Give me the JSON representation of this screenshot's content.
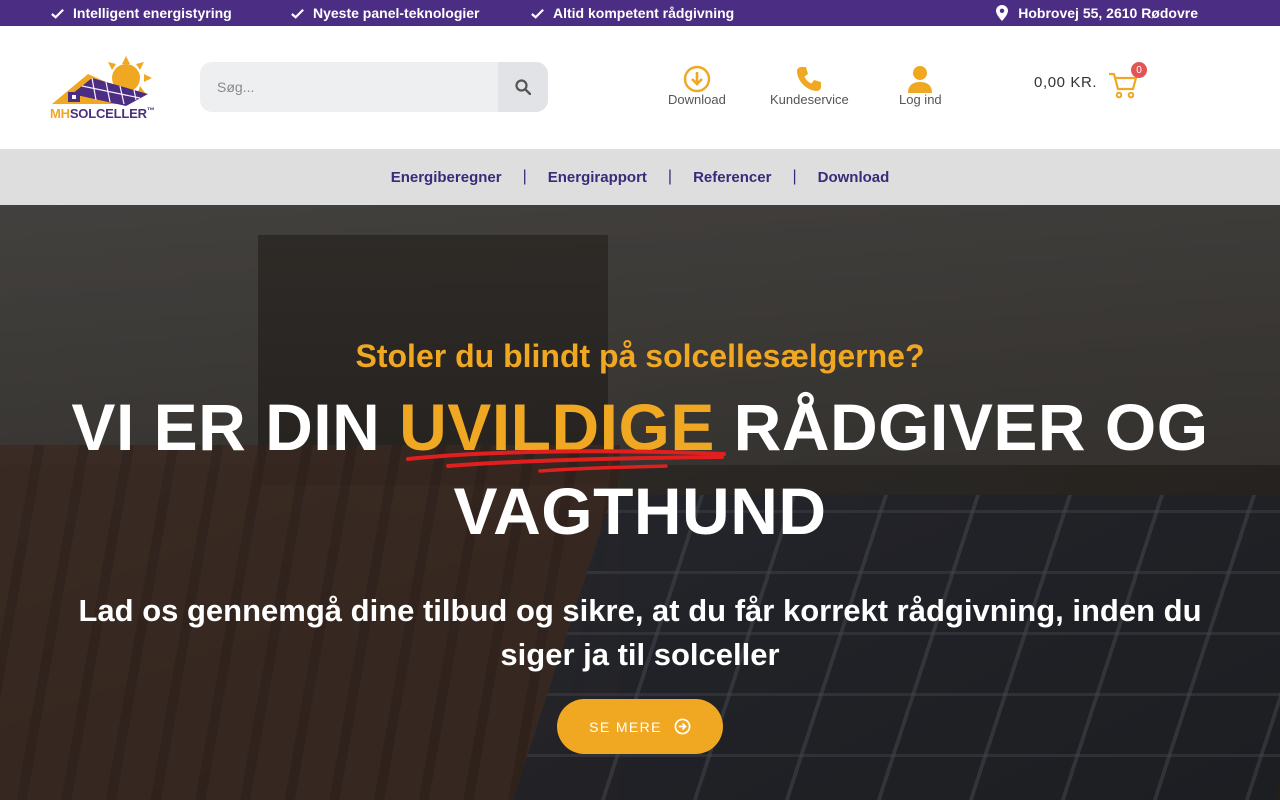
{
  "topbar": {
    "usps": [
      "Intelligent energistyring",
      "Nyeste panel-teknologier",
      "Altid kompetent rådgivning"
    ],
    "address": "Hobrovej 55, 2610 Rødovre"
  },
  "header": {
    "logo": {
      "prefix": "MH",
      "name": "SOLCELLER",
      "tm": "™"
    },
    "search": {
      "placeholder": "Søg..."
    },
    "icons": {
      "download": "Download",
      "customer_service": "Kundeservice",
      "login": "Log ind"
    },
    "cart": {
      "amount": "0,00 KR.",
      "count": "0"
    }
  },
  "nav": {
    "items": [
      "Energiberegner",
      "Energirapport",
      "Referencer",
      "Download"
    ],
    "separator": "|"
  },
  "hero": {
    "kicker": "Stoler du blindt på solcellesælgerne?",
    "headline_pre": "VI ER DIN ",
    "headline_highlight": "UVILDIGE",
    "headline_post": " RÅDGIVER OG",
    "headline_line2": "VAGTHUND",
    "subtitle": "Lad os gennemgå dine tilbud og sikre, at du får korrekt rådgivning, inden du siger ja til solceller",
    "cta_label": "SE MERE"
  },
  "colors": {
    "brand_purple": "#4b2e83",
    "accent_orange": "#f0a823",
    "underline_red": "#e21f1f",
    "badge_red": "#e35555",
    "nav_bg": "#dedede"
  }
}
